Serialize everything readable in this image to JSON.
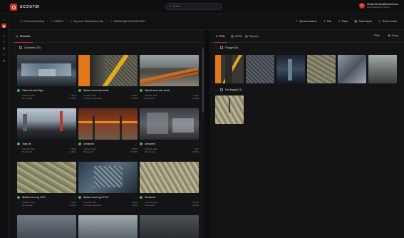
{
  "app": {
    "name": "SCOUTDI"
  },
  "search": {
    "placeholder": "Search"
  },
  "user": {
    "initial": "E",
    "email": "eirmat.eierman@scoutdi.com",
    "org": "Scout Marketing • Admin"
  },
  "breadcrumbs": [
    "DI Scout Marketing",
    "DEMA 2",
    "Dry dock / Maintenance bay",
    "DEMA2 flight test 2025-06-01"
  ],
  "actions": [
    "Upload sessions",
    "Edit",
    "Share",
    "Reset layout",
    "Screen mode"
  ],
  "left": {
    "tab": "Sessions",
    "group": "Uploaded (15)",
    "cards": [
      {
        "title": "Gate lock test flight",
        "meta1_l": "Unknown date",
        "meta1_r": "4 POIs",
        "meta2_l": "16 seconds",
        "meta2_r": "0 UTMs"
      },
      {
        "title": "Splash zone test struts",
        "meta1_l": "Unknown date",
        "meta1_r": "5 POIs",
        "meta2_l": "1 minute 11 seconds",
        "meta2_r": "0 UTMs"
      },
      {
        "title": "Splash zone test struts",
        "meta1_l": "Unknown date",
        "meta1_r": "4 POIs",
        "meta2_l": "34 seconds",
        "meta2_r": "0 UTMs"
      },
      {
        "title": "Take-off",
        "meta1_l": "Unknown date",
        "meta1_r": "3 POIs",
        "meta2_l": "51 seconds",
        "meta2_r": "0 UTMs"
      },
      {
        "title": "Unnamed",
        "meta1_l": "Unknown date",
        "meta1_r": "2 POIs",
        "meta2_l": "38 seconds",
        "meta2_r": "0 UTMs"
      },
      {
        "title": "Unnamed",
        "meta1_l": "Unknown date",
        "meta1_r": "1 POI",
        "meta2_l": "40 seconds",
        "meta2_r": "0 UTMs"
      },
      {
        "title": "Splash zone rig UTM",
        "meta1_l": "Unknown date",
        "meta1_r": "4 POIs",
        "meta2_l": "49 seconds",
        "meta2_r": "4 UTMs"
      },
      {
        "title": "Splash zone rig UTM 2",
        "meta1_l": "Unknown date",
        "meta1_r": "4 POIs",
        "meta2_l": "1 minute 4 seconds",
        "meta2_r": "1 UTM"
      },
      {
        "title": "Unnamed",
        "meta1_l": "Unknown date",
        "meta1_r": "2 POIs",
        "meta2_l": "26 seconds",
        "meta2_r": "0 UTMs"
      }
    ]
  },
  "right": {
    "tabs": [
      "POIs",
      "UTMs",
      "Reports"
    ],
    "filter": "Filter",
    "group_btn": "Group",
    "flagged": "Flagged (6)",
    "not_flagged": "Not flagged (1)"
  }
}
